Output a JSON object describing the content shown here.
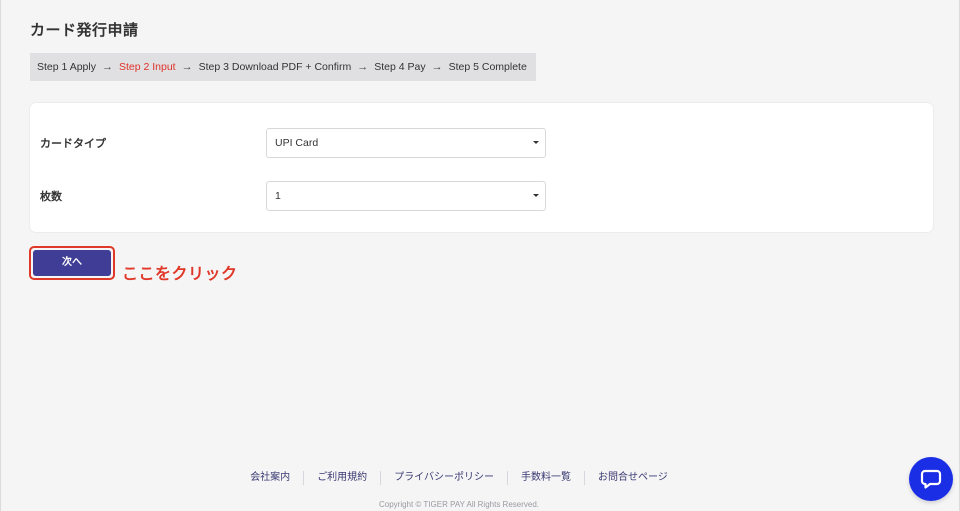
{
  "page": {
    "title": "カード発行申請"
  },
  "stepper": {
    "steps": [
      {
        "label": "Step 1 Apply",
        "active": false
      },
      {
        "label": "Step 2 Input",
        "active": true
      },
      {
        "label": "Step 3 Download PDF + Confirm",
        "active": false
      },
      {
        "label": "Step 4 Pay",
        "active": false
      },
      {
        "label": "Step 5 Complete",
        "active": false
      }
    ],
    "arrow": "→"
  },
  "form": {
    "card_type": {
      "label": "カードタイプ",
      "value": "UPI Card"
    },
    "quantity": {
      "label": "枚数",
      "value": "1"
    }
  },
  "next_button": {
    "label": "次へ"
  },
  "annotation": {
    "text": "ここをクリック"
  },
  "footer": {
    "links": [
      "会社案内",
      "ご利用規約",
      "プライバシーポリシー",
      "手数料一覧",
      "お問合せページ"
    ],
    "copyright": "Copyright © TIGER PAY All Rights Reserved."
  },
  "colors": {
    "active_step": "#e0322a",
    "primary_button": "#3f3d96",
    "annotation": "#e0392a",
    "chat_button": "#1a2ee6"
  },
  "icons": {
    "chat": "chat-bubble-icon",
    "caret": "caret-down-icon"
  }
}
